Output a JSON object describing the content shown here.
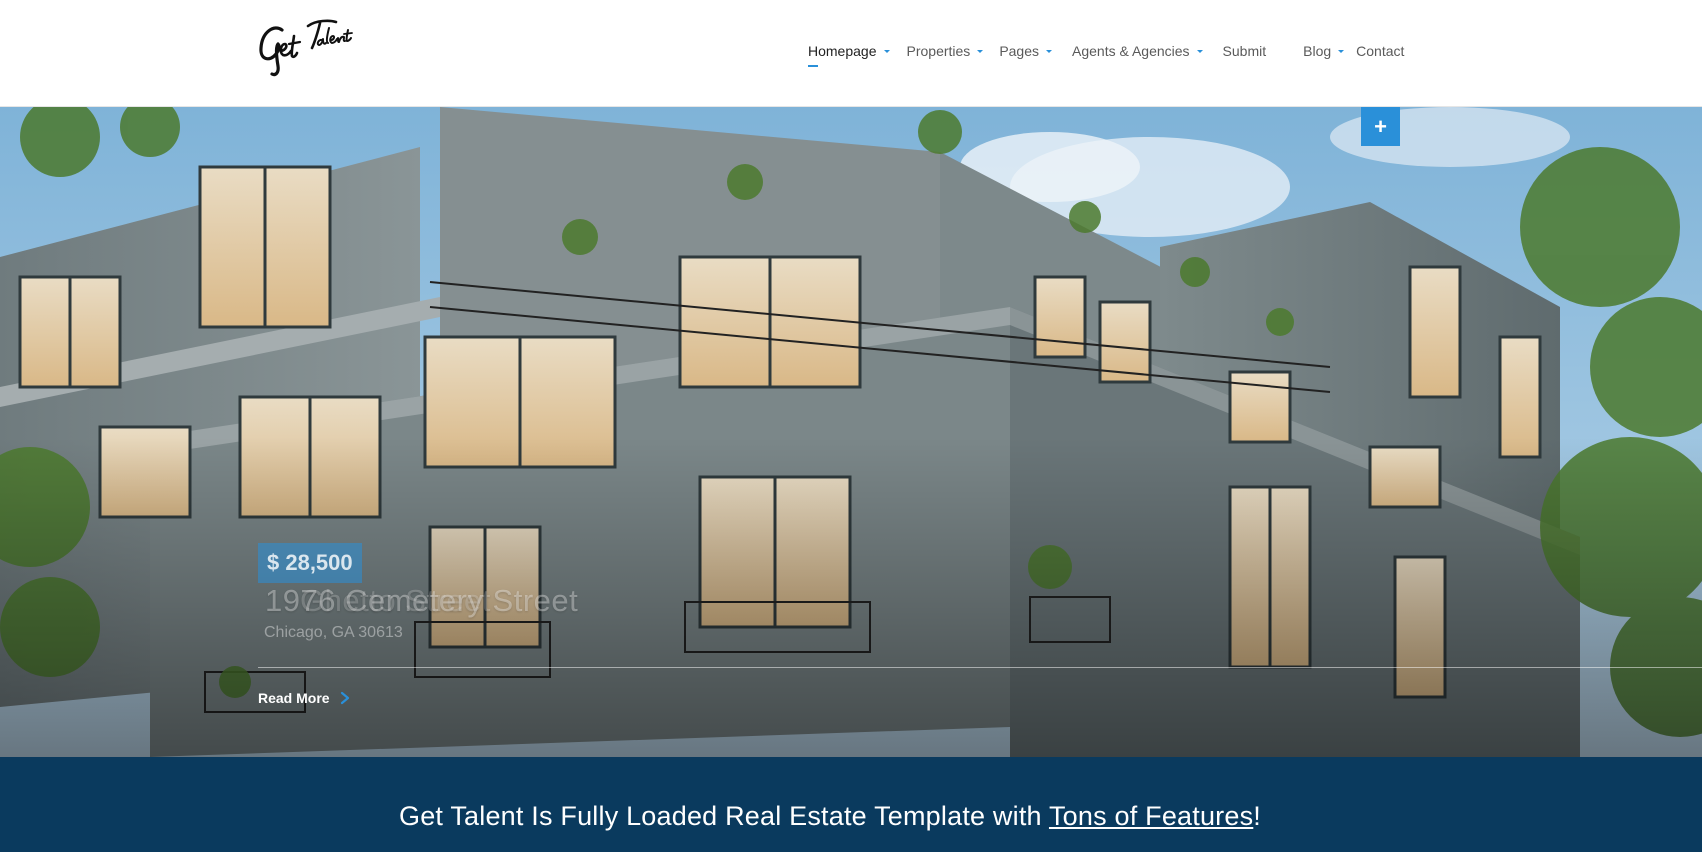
{
  "brand": {
    "logo_text": "Get Talent"
  },
  "nav": {
    "items": [
      {
        "label": "Homepage",
        "has_dropdown": true,
        "active": true
      },
      {
        "label": "Properties",
        "has_dropdown": true
      },
      {
        "label": "Pages",
        "has_dropdown": true
      },
      {
        "label": "Agents & Agencies",
        "has_dropdown": true
      },
      {
        "label": "Submit",
        "has_dropdown": false
      },
      {
        "label": "Blog",
        "has_dropdown": true
      },
      {
        "label": "Contact",
        "has_dropdown": false
      }
    ]
  },
  "hero": {
    "add_button": "+",
    "price": "$ 28,500",
    "title": "1976 Cemetery Street",
    "title_ghost": "Ghetto Street",
    "subtitle": "Chicago, GA 30613",
    "read_more": "Read More"
  },
  "banner": {
    "text_before": "Get Talent Is Fully Loaded Real Estate Template with ",
    "link_text": "Tons of Features",
    "text_after": "!"
  },
  "colors": {
    "accent": "#2a90d9",
    "banner_bg": "#0a3a5e",
    "nav_text": "#5a5a5a",
    "nav_active": "#222222"
  },
  "icons": [
    "caret-down-icon",
    "plus-icon",
    "chevron-right-icon"
  ]
}
